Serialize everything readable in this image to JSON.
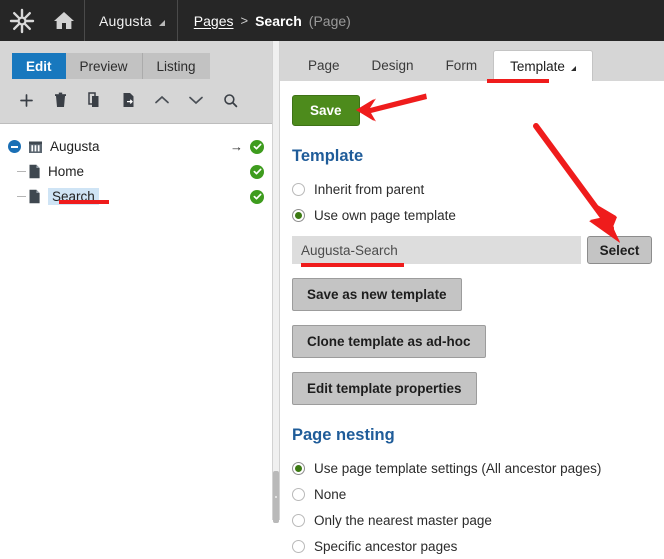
{
  "header": {
    "logo_icon": "starburst-logo-icon",
    "home_icon": "home-icon",
    "site_name": "Augusta",
    "breadcrumb": {
      "root_label": "Pages",
      "separator": ">",
      "current_label": "Search",
      "type_label": "(Page)"
    }
  },
  "left_panel": {
    "mode_tabs": [
      {
        "label": "Edit",
        "active": true
      },
      {
        "label": "Preview",
        "active": false
      },
      {
        "label": "Listing",
        "active": false
      }
    ],
    "toolbar_icons": [
      {
        "name": "add-page-icon",
        "title": "Add"
      },
      {
        "name": "delete-page-icon",
        "title": "Delete"
      },
      {
        "name": "copy-page-icon",
        "title": "Copy"
      },
      {
        "name": "move-page-icon",
        "title": "Move"
      },
      {
        "name": "chevron-up-icon",
        "title": "Up"
      },
      {
        "name": "chevron-down-icon",
        "title": "Down"
      },
      {
        "name": "search-icon",
        "title": "Search"
      }
    ],
    "tree": [
      {
        "label": "Augusta",
        "level": 0,
        "icon": "site-icon",
        "expanded": true,
        "selected": false,
        "has_arrow": true,
        "status": "published"
      },
      {
        "label": "Home",
        "level": 1,
        "icon": "page-icon",
        "expanded": false,
        "selected": false,
        "has_arrow": false,
        "status": "published"
      },
      {
        "label": "Search",
        "level": 1,
        "icon": "page-icon",
        "expanded": false,
        "selected": true,
        "has_arrow": false,
        "status": "published"
      }
    ]
  },
  "right_panel": {
    "tabs": [
      {
        "label": "Page",
        "active": false,
        "has_caret": false
      },
      {
        "label": "Design",
        "active": false,
        "has_caret": false
      },
      {
        "label": "Form",
        "active": false,
        "has_caret": false
      },
      {
        "label": "Template",
        "active": true,
        "has_caret": true
      }
    ],
    "save_label": "Save",
    "template_section": {
      "title": "Template",
      "options": [
        {
          "label": "Inherit from parent",
          "checked": false
        },
        {
          "label": "Use own page template",
          "checked": true
        }
      ],
      "template_value": "Augusta-Search",
      "template_placeholder": "",
      "select_label": "Select",
      "buttons": [
        {
          "label": "Save as new template"
        },
        {
          "label": "Clone template as ad-hoc"
        },
        {
          "label": "Edit template properties"
        }
      ]
    },
    "page_nesting_section": {
      "title": "Page nesting",
      "options": [
        {
          "label": "Use page template settings (All ancestor pages)",
          "checked": true
        },
        {
          "label": "None",
          "checked": false
        },
        {
          "label": "Only the nearest master page",
          "checked": false
        },
        {
          "label": "Specific ancestor pages",
          "checked": false
        }
      ]
    }
  },
  "annotations": {
    "color": "#ef1c1c",
    "items": [
      {
        "name": "underline-search-node",
        "type": "underline"
      },
      {
        "name": "underline-template-tab",
        "type": "underline"
      },
      {
        "name": "underline-template-value",
        "type": "underline"
      },
      {
        "name": "arrow-to-save-button",
        "type": "arrow"
      },
      {
        "name": "arrow-to-select-button",
        "type": "arrow"
      }
    ]
  }
}
